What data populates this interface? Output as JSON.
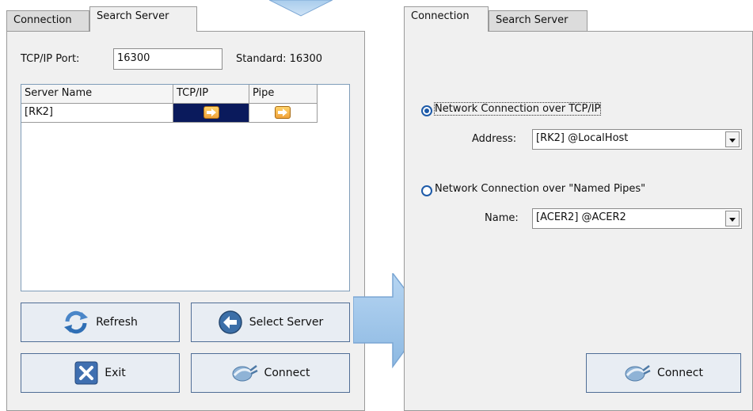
{
  "left_panel": {
    "tabs": [
      "Connection",
      "Search Server"
    ],
    "port_label": "TCP/IP Port:",
    "port_value": "16300",
    "standard_label": "Standard: 16300",
    "table": {
      "headers": [
        "Server Name",
        "TCP/IP",
        "Pipe"
      ],
      "rows": [
        {
          "name": "[RK2]"
        }
      ]
    },
    "buttons": {
      "refresh": "Refresh",
      "select_server": "Select Server",
      "exit": "Exit",
      "connect": "Connect"
    }
  },
  "right_panel": {
    "tabs": [
      "Connection",
      "Search Server"
    ],
    "tcp_option": "Network Connection over TCP/IP",
    "address_label": "Address:",
    "address_value": "[RK2] @LocalHost",
    "pipe_option": "Network Connection over \"Named Pipes\"",
    "name_label": "Name:",
    "name_value": "[ACER2] @ACER2",
    "connect_button": "Connect"
  },
  "colors": {
    "accent": "#1d5aa8",
    "selected_cell": "#0a1a5c",
    "arrow_fill": "#a8ccec"
  }
}
